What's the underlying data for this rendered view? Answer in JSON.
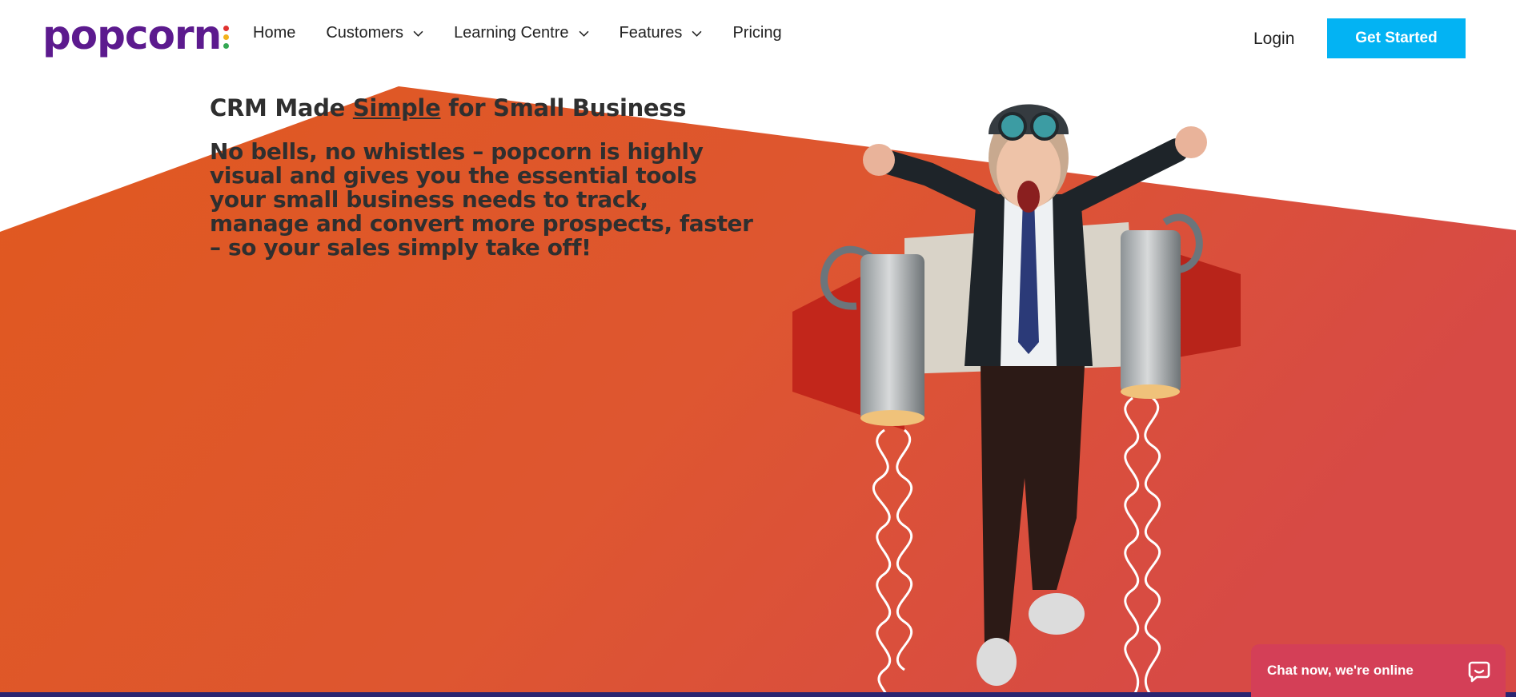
{
  "brand": {
    "logo_text": "popcorn",
    "dot_colors": [
      "#e0322f",
      "#f2b21b",
      "#34a853"
    ],
    "purple": "#5c1a8e"
  },
  "nav": {
    "items": [
      {
        "label": "Home",
        "has_dropdown": false
      },
      {
        "label": "Customers",
        "has_dropdown": true
      },
      {
        "label": "Learning Centre",
        "has_dropdown": true
      },
      {
        "label": "Features",
        "has_dropdown": true
      },
      {
        "label": "Pricing",
        "has_dropdown": false
      }
    ],
    "login_label": "Login",
    "cta_label": "Get Started",
    "cta_color": "#03b3f3"
  },
  "hero": {
    "title_before": "CRM Made ",
    "title_emphasis": "Simple",
    "title_after": " for Small Business",
    "subtitle": "No bells, no whistles – popcorn is highly visual and gives you the essential tools your small business needs to track, manage and convert more prospects, faster – so your sales simply take off!",
    "gradient_colors": [
      "#e0591f",
      "#d84a43"
    ]
  },
  "chat": {
    "label": "Chat now, we're online",
    "icon": "chat-bubble-icon",
    "color": "#d43f57"
  }
}
